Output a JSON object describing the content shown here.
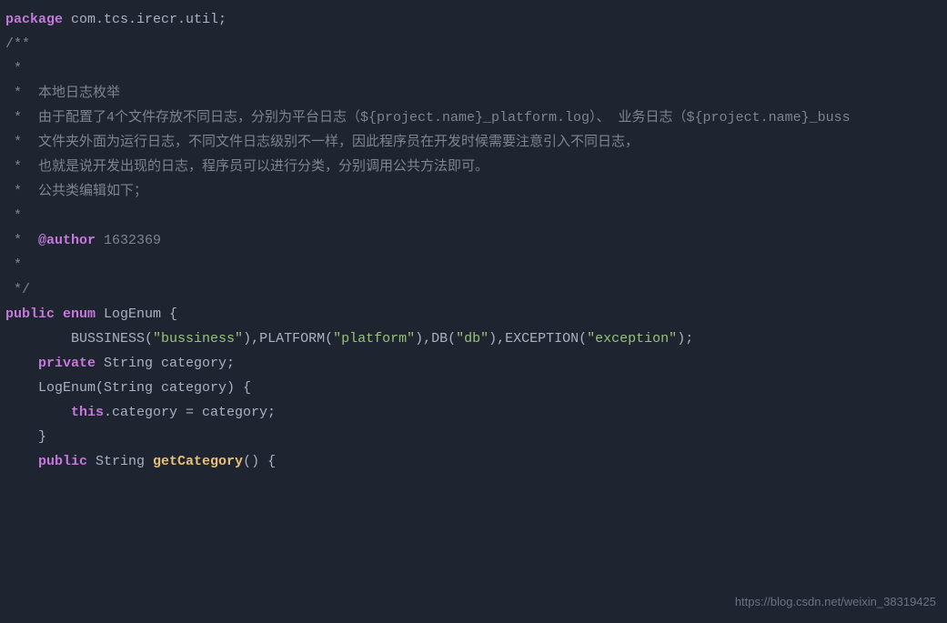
{
  "code": {
    "line1_kw1": "package",
    "line1_pkg": " com.tcs.irecr.util;",
    "line2": "/**",
    "line3": " *",
    "line4": " *  本地日志枚举",
    "line5": " *  由于配置了4个文件存放不同日志，分别为平台日志（${project.name}_platform.log）、 业务日志（${project.name}_buss",
    "line6": " *  文件夹外面为运行日志，不同文件日志级别不一样，因此程序员在开发时候需要注意引入不同日志，",
    "line7": " *  也就是说开发出现的日志，程序员可以进行分类，分别调用公共方法即可。",
    "line8": " *  公共类编辑如下；",
    "line9": " *",
    "line10_pre": " *  ",
    "line10_tag": "@author",
    "line10_post": " 1632369",
    "line11": " *",
    "line12": " */",
    "line13_kw1": "public",
    "line13_kw2": " enum",
    "line13_rest": " LogEnum {",
    "line14": "",
    "line15_pre": "        BUSSINESS(",
    "line15_str1": "\"bussiness\"",
    "line15_mid1": "),PLATFORM(",
    "line15_str2": "\"platform\"",
    "line15_mid2": "),DB(",
    "line15_str3": "\"db\"",
    "line15_mid3": "),EXCEPTION(",
    "line15_str4": "\"exception\"",
    "line15_end": ");",
    "line16": "",
    "line17": "",
    "line18_pre": "    ",
    "line18_kw": "private",
    "line18_rest": " String category;",
    "line19": "",
    "line20": "",
    "line21": "    LogEnum(String category) {",
    "line22_pre": "        ",
    "line22_kw": "this",
    "line22_rest": ".category = category;",
    "line23": "    }",
    "line24": "",
    "line25_pre": "    ",
    "line25_kw": "public",
    "line25_type": " String ",
    "line25_method": "getCategory",
    "line25_rest": "() {"
  },
  "watermark": "https://blog.csdn.net/weixin_38319425"
}
